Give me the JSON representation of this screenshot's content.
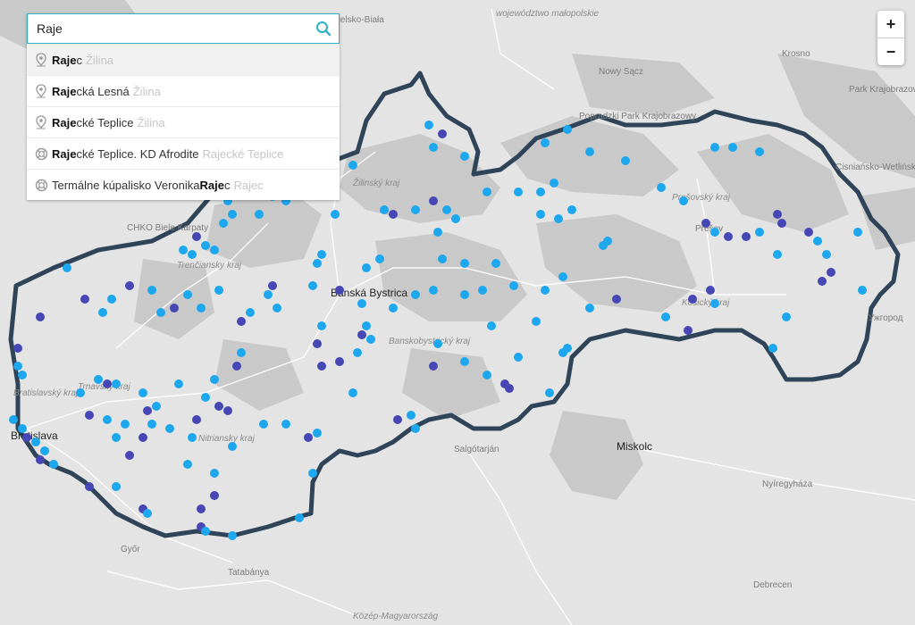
{
  "search": {
    "value": "Raje",
    "suggestions": [
      {
        "pre": "",
        "bold": "Raje",
        "post": "c",
        "context": "Žilina",
        "icon": "location-pin-icon"
      },
      {
        "pre": "",
        "bold": "Raje",
        "post": "cká Lesná",
        "context": "Žilina",
        "icon": "location-pin-icon"
      },
      {
        "pre": "",
        "bold": "Raje",
        "post": "cké Teplice",
        "context": "Žilina",
        "icon": "location-pin-icon"
      },
      {
        "pre": "",
        "bold": "Raje",
        "post": "cké Teplice. KD Afrodite",
        "context": "Rajecké Teplice",
        "icon": "lifebuoy-icon"
      },
      {
        "pre": "Termálne kúpalisko Veronika ",
        "bold": "Raje",
        "post": "c",
        "context": "Rajec",
        "icon": "lifebuoy-icon"
      }
    ]
  },
  "zoom": {
    "in": "+",
    "out": "−"
  },
  "map": {
    "cities": [
      "Bratislava",
      "Banská Bystrica",
      "Miskolc",
      "Bielsko-Biała",
      "Nowy Sącz",
      "Krosno",
      "Prešov",
      "Salgótarján",
      "Nyíregyháza",
      "Győr",
      "Tatabánya",
      "Debrecen",
      "Ужгород"
    ],
    "regions": [
      "województwo małopolskie",
      "Žilinský kraj",
      "Trenčiansky kraj",
      "Prešovský kraj",
      "Košický kraj",
      "Banskobystrický kraj",
      "Trnavský kraj",
      "Nitriansky kraj",
      "Bratislavský kraj",
      "Közép-Magyarország"
    ],
    "parks": [
      "CHKO Biele Karpaty",
      "Popradzki Park Krajobrazowy",
      "Park Krajobrazowy Gór Słonnych",
      "Cisniańsko-Wetliński Park Krajobrazowy"
    ]
  },
  "colors": {
    "border": "#2f4459",
    "marker_light": "#1da7ee",
    "marker_dark": "#4647b4",
    "accent": "#2bb3c8"
  }
}
